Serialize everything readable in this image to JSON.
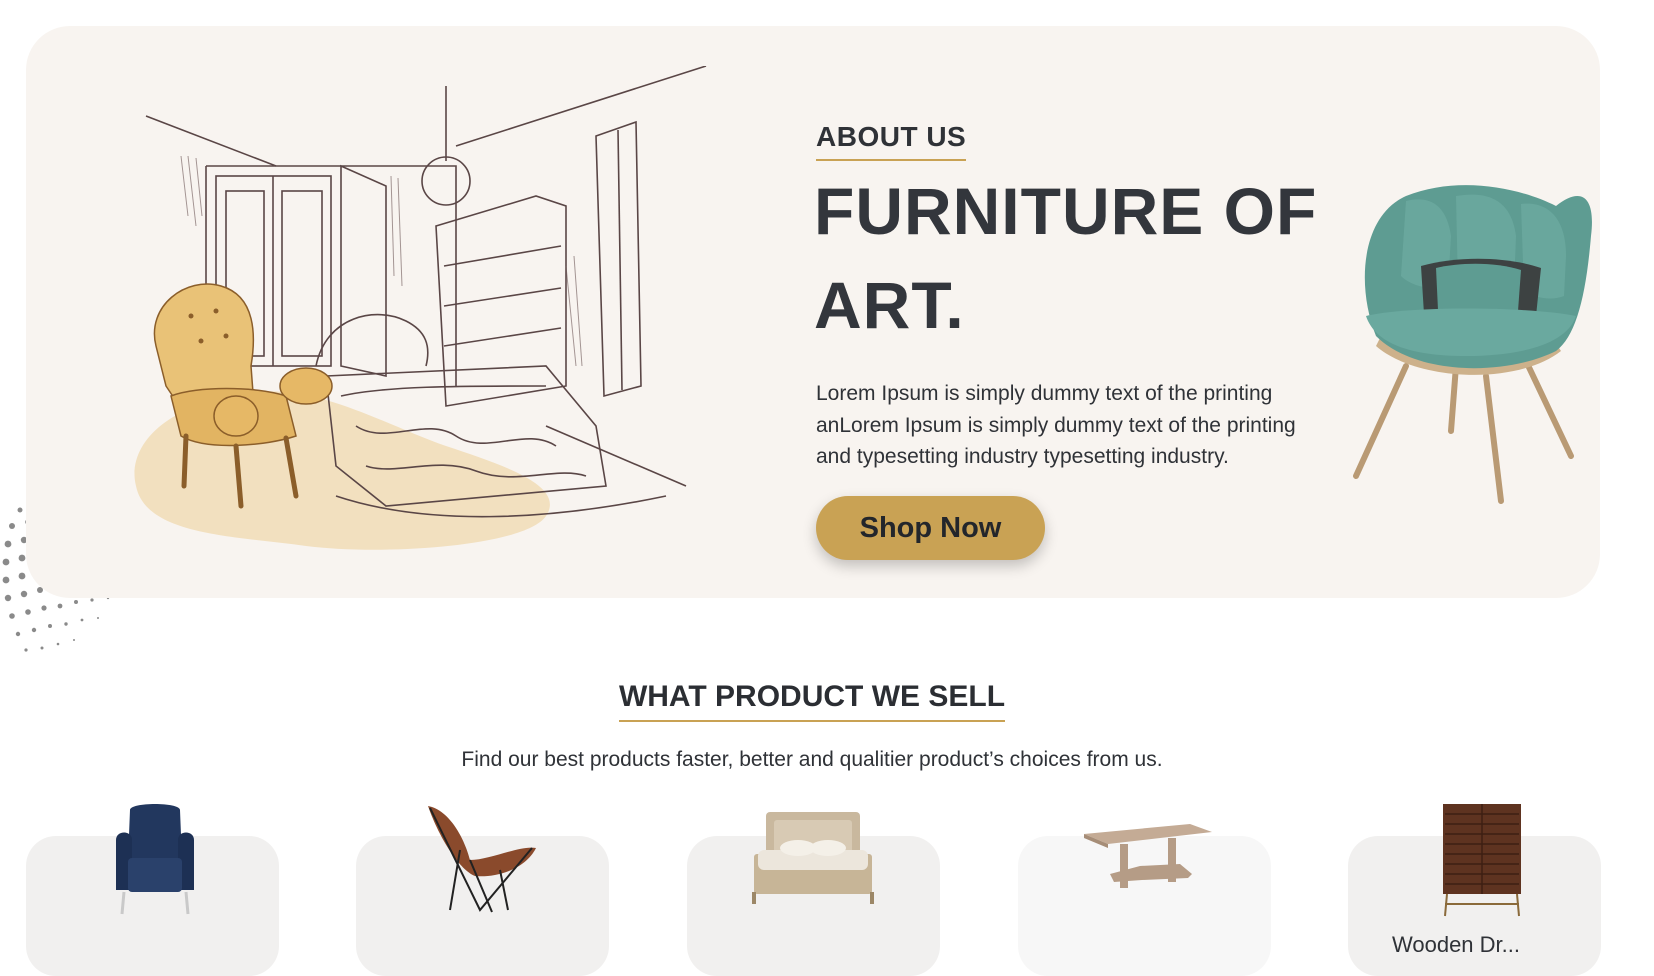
{
  "hero": {
    "about_label": "ABOUT US",
    "headline": "FURNITURE OF ART.",
    "description": "Lorem Ipsum is simply dummy text of the printing anLorem Ipsum is simply dummy text of the printing and typesetting industry typesetting industry.",
    "cta_label": "Shop Now"
  },
  "products_section": {
    "title": "WHAT PRODUCT WE SELL",
    "subtitle": "Find our best products faster, better and qualitier product’s choices from us.",
    "cards": [
      {
        "icon": "wingback-chair"
      },
      {
        "icon": "butterfly-chair"
      },
      {
        "icon": "bed"
      },
      {
        "icon": "wooden-table"
      },
      {
        "icon": "wooden-cabinet",
        "label": "Wooden Dr..."
      }
    ]
  },
  "colors": {
    "hero_bg": "#f8f4f0",
    "accent": "#c9a254",
    "text_dark": "#2f3237",
    "chair_teal": "#5e9c92"
  }
}
